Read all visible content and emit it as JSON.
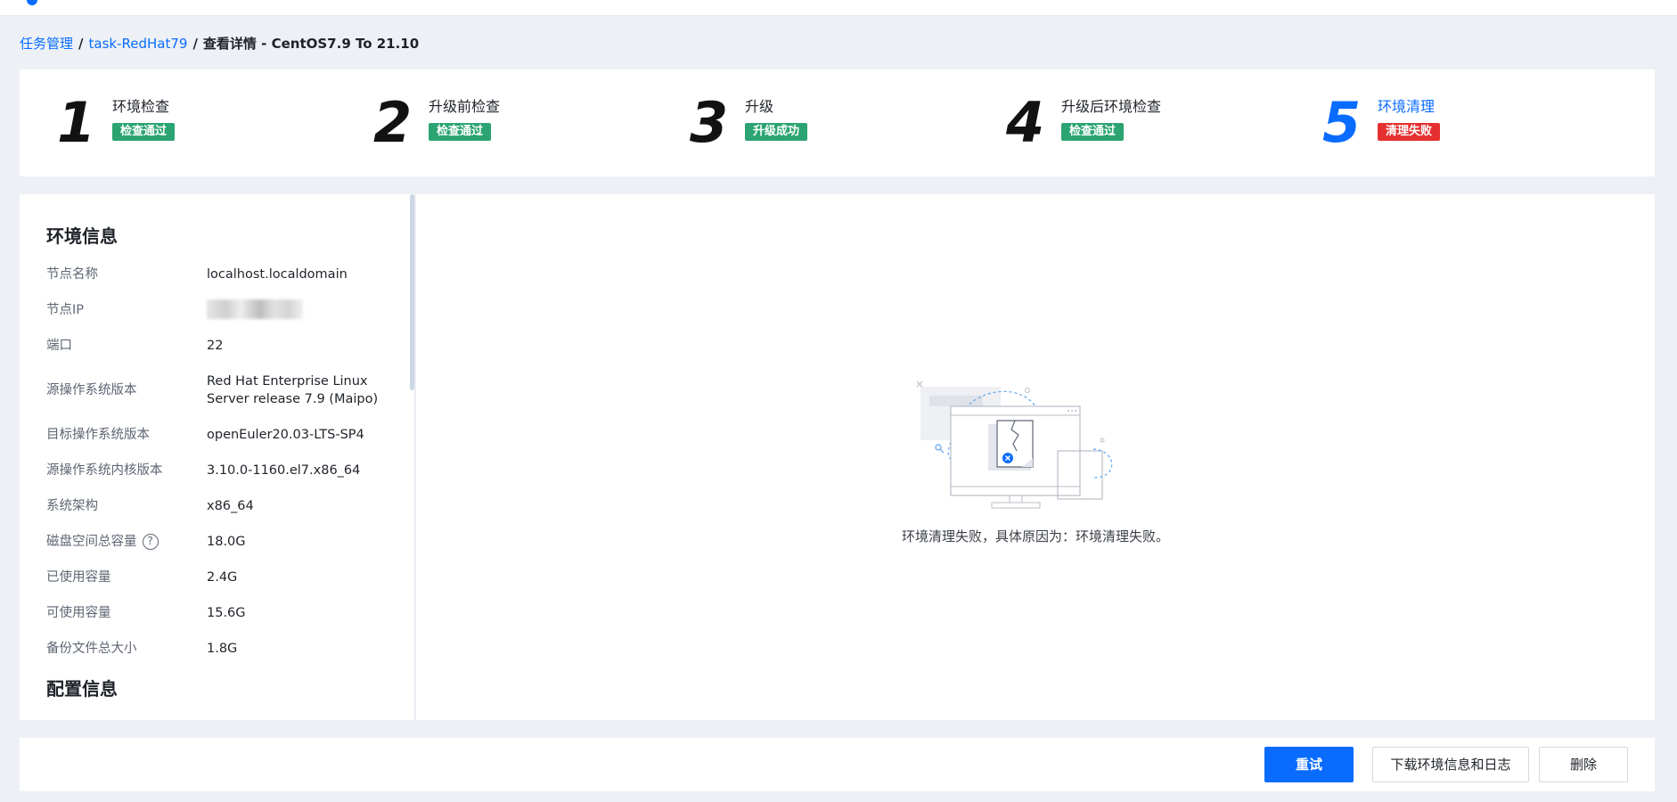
{
  "breadcrumb": {
    "items": [
      "任务管理",
      "task-RedHat79"
    ],
    "separator": "/",
    "current": "查看详情 - CentOS7.9 To 21.10"
  },
  "steps": [
    {
      "number": "1",
      "title": "环境检查",
      "status": "检查通过"
    },
    {
      "number": "2",
      "title": "升级前检查",
      "status": "检查通过"
    },
    {
      "number": "3",
      "title": "升级",
      "status": "升级成功"
    },
    {
      "number": "4",
      "title": "升级后环境检查",
      "status": "检查通过"
    },
    {
      "number": "5",
      "title": "环境清理",
      "status": "清理失败"
    }
  ],
  "env_info": {
    "title": "环境信息",
    "rows": [
      {
        "label": "节点名称",
        "value": "localhost.localdomain"
      },
      {
        "label": "节点IP",
        "value": ""
      },
      {
        "label": "端口",
        "value": "22"
      },
      {
        "label": "源操作系统版本",
        "value": "Red Hat Enterprise Linux Server release 7.9 (Maipo)"
      },
      {
        "label": "目标操作系统版本",
        "value": "openEuler20.03-LTS-SP4"
      },
      {
        "label": "源操作系统内核版本",
        "value": "3.10.0-1160.el7.x86_64"
      },
      {
        "label": "系统架构",
        "value": "x86_64"
      },
      {
        "label": "磁盘空间总容量",
        "value": "18.0G"
      },
      {
        "label": "已使用容量",
        "value": "2.4G"
      },
      {
        "label": "可使用容量",
        "value": "15.6G"
      },
      {
        "label": "备份文件总大小",
        "value": "1.8G"
      }
    ]
  },
  "config_info": {
    "title": "配置信息"
  },
  "empty_state": {
    "message": "环境清理失败，具体原因为：环境清理失败。"
  },
  "footer": {
    "retry_label": "重试",
    "download_label": "下载环境信息和日志",
    "delete_label": "删除"
  },
  "colors": {
    "primary": "#0a6cff",
    "success": "#2ba471",
    "error": "#e5302f",
    "background": "#edf1f6"
  }
}
